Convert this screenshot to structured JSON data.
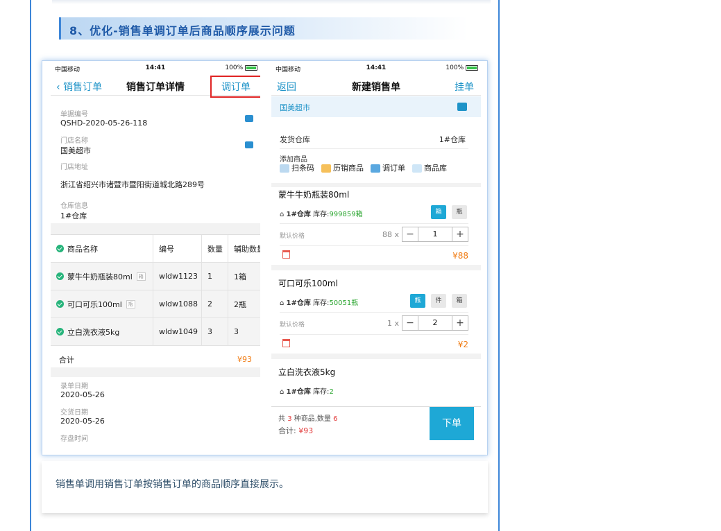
{
  "section": {
    "title": "8、优化-销售单调订单后商品顺序展示问题"
  },
  "caption": "销售单调用销售订单按销售订单的商品顺序直接展示。",
  "left_phone": {
    "status": {
      "carrier": "中国移动",
      "time": "14:41",
      "battery": "100%"
    },
    "nav": {
      "back": "销售订单",
      "title": "销售订单详情",
      "action": "调订单"
    },
    "fields": {
      "doc_no_label": "单据编号",
      "doc_no": "QSHD-2020-05-26-118",
      "store_label": "门店名称",
      "store": "国美超市",
      "address_label": "门店地址",
      "address": "浙江省绍兴市诸暨市暨阳街道城北路289号",
      "warehouse_label": "仓库信息",
      "warehouse": "1#仓库"
    },
    "table": {
      "headers": [
        "商品名称",
        "编号",
        "数量",
        "辅助数量"
      ],
      "rows": [
        {
          "name": "蒙牛牛奶瓶装80ml",
          "unit": "箱",
          "code": "wldw1123",
          "qty": "1",
          "aux": "1箱"
        },
        {
          "name": "可口可乐100ml",
          "unit": "瓶",
          "code": "wldw1088",
          "qty": "2",
          "aux": "2瓶"
        },
        {
          "name": "立白洗衣液5kg",
          "unit": "",
          "code": "wldw1049",
          "qty": "3",
          "aux": "3"
        }
      ],
      "total_label": "合计",
      "total": "¥93"
    },
    "dates": {
      "entry_label": "录单日期",
      "entry": "2020-05-26",
      "delivery_label": "交货日期",
      "delivery": "2020-05-26",
      "stock_label": "存盘时间"
    }
  },
  "right_phone": {
    "status": {
      "carrier": "中国移动",
      "time": "14:41",
      "battery": "100%"
    },
    "nav": {
      "back": "返回",
      "title": "新建销售单",
      "action": "挂单"
    },
    "store": "国美超市",
    "ship_wh_label": "发货仓库",
    "ship_wh": "1#仓库",
    "add_label": "添加商品",
    "tools": [
      "扫条码",
      "历销商品",
      "调订单",
      "商品库"
    ],
    "products": [
      {
        "name": "蒙牛牛奶瓶装80ml",
        "wh": "1#仓库",
        "stock_label": "库存:",
        "stock": "999859箱",
        "units": [
          "箱",
          "瓶"
        ],
        "price_label": "默认价格",
        "price": "88 x",
        "qty": "1",
        "amount": "¥88"
      },
      {
        "name": "可口可乐100ml",
        "wh": "1#仓库",
        "stock_label": "库存:",
        "stock": "50051瓶",
        "units": [
          "瓶",
          "件",
          "箱"
        ],
        "price_label": "默认价格",
        "price": "1 x",
        "qty": "2",
        "amount": "¥2"
      },
      {
        "name": "立白洗衣液5kg",
        "wh": "1#仓库",
        "stock_label": "库存:",
        "stock": "2"
      }
    ],
    "footer": {
      "prefix": "共",
      "kinds": "3",
      "mid": "种商品,数量",
      "count": "6",
      "total_label": "合计:",
      "total": "¥93",
      "submit": "下单"
    }
  }
}
